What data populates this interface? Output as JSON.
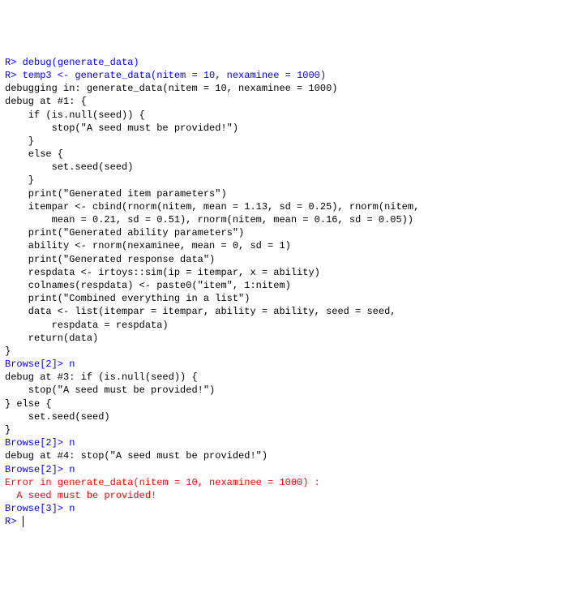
{
  "lines": [
    {
      "type": "input",
      "prompt": "R> ",
      "text": "debug(generate_data)"
    },
    {
      "type": "input",
      "prompt": "R> ",
      "text": "temp3 <- generate_data(nitem = 10, nexaminee = 1000)"
    },
    {
      "type": "output",
      "text": "debugging in: generate_data(nitem = 10, nexaminee = 1000)"
    },
    {
      "type": "output",
      "text": "debug at #1: {"
    },
    {
      "type": "output",
      "text": "    if (is.null(seed)) {"
    },
    {
      "type": "output",
      "text": "        stop(\"A seed must be provided!\")"
    },
    {
      "type": "output",
      "text": "    }"
    },
    {
      "type": "output",
      "text": "    else {"
    },
    {
      "type": "output",
      "text": "        set.seed(seed)"
    },
    {
      "type": "output",
      "text": "    }"
    },
    {
      "type": "output",
      "text": "    print(\"Generated item parameters\")"
    },
    {
      "type": "output",
      "text": "    itempar <- cbind(rnorm(nitem, mean = 1.13, sd = 0.25), rnorm(nitem,"
    },
    {
      "type": "output",
      "text": "        mean = 0.21, sd = 0.51), rnorm(nitem, mean = 0.16, sd = 0.05))"
    },
    {
      "type": "output",
      "text": "    print(\"Generated ability parameters\")"
    },
    {
      "type": "output",
      "text": "    ability <- rnorm(nexaminee, mean = 0, sd = 1)"
    },
    {
      "type": "output",
      "text": "    print(\"Generated response data\")"
    },
    {
      "type": "output",
      "text": "    respdata <- irtoys::sim(ip = itempar, x = ability)"
    },
    {
      "type": "output",
      "text": "    colnames(respdata) <- paste0(\"item\", 1:nitem)"
    },
    {
      "type": "output",
      "text": "    print(\"Combined everything in a list\")"
    },
    {
      "type": "output",
      "text": "    data <- list(itempar = itempar, ability = ability, seed = seed,"
    },
    {
      "type": "output",
      "text": "        respdata = respdata)"
    },
    {
      "type": "output",
      "text": "    return(data)"
    },
    {
      "type": "output",
      "text": "}"
    },
    {
      "type": "input",
      "prompt": "Browse[2]> ",
      "text": "n"
    },
    {
      "type": "output",
      "text": "debug at #3: if (is.null(seed)) {"
    },
    {
      "type": "output",
      "text": "    stop(\"A seed must be provided!\")"
    },
    {
      "type": "output",
      "text": "} else {"
    },
    {
      "type": "output",
      "text": "    set.seed(seed)"
    },
    {
      "type": "output",
      "text": "}"
    },
    {
      "type": "input",
      "prompt": "Browse[2]> ",
      "text": "n"
    },
    {
      "type": "output",
      "text": "debug at #4: stop(\"A seed must be provided!\")"
    },
    {
      "type": "input",
      "prompt": "Browse[2]> ",
      "text": "n"
    },
    {
      "type": "error",
      "text": "Error in generate_data(nitem = 10, nexaminee = 1000) :"
    },
    {
      "type": "error",
      "text": "  A seed must be provided!"
    },
    {
      "type": "input",
      "prompt": "Browse[3]> ",
      "text": "n"
    },
    {
      "type": "input",
      "prompt": "R> ",
      "text": "",
      "cursor": true
    }
  ]
}
